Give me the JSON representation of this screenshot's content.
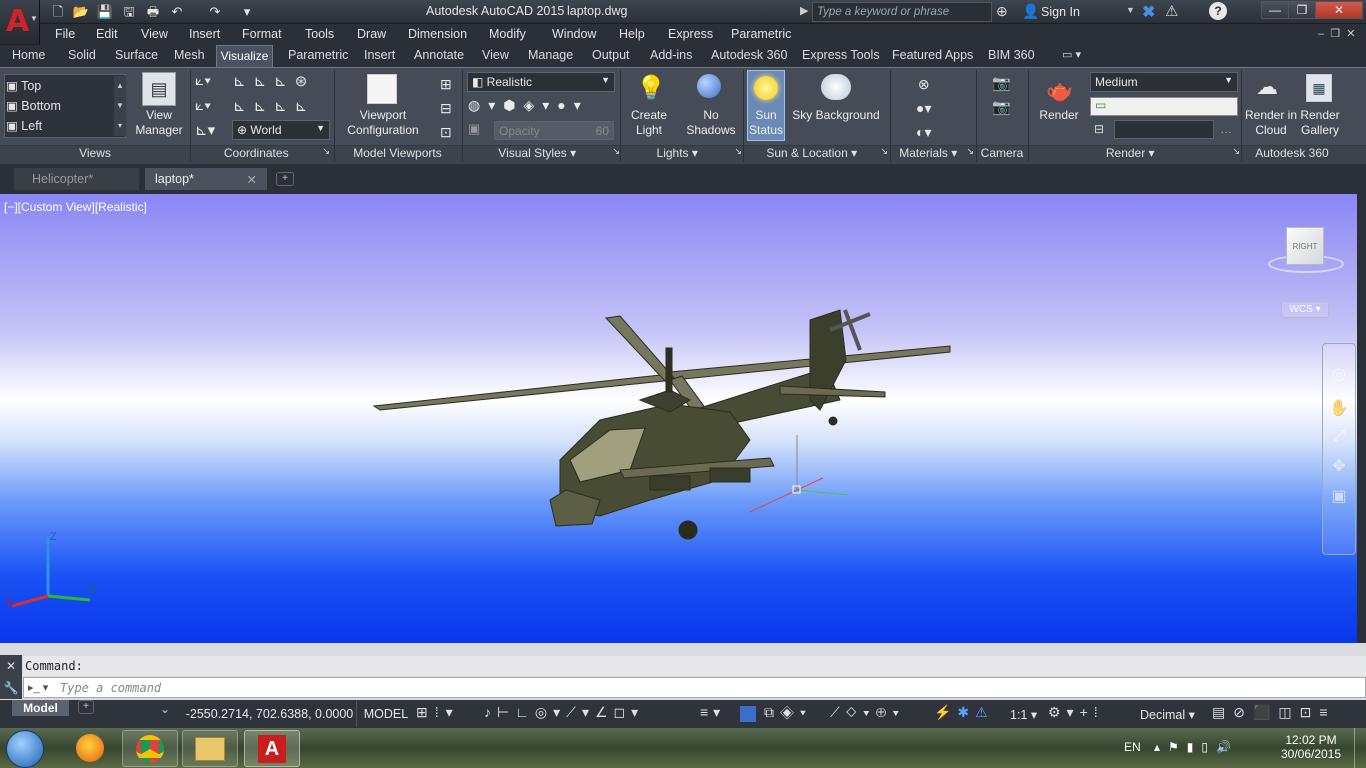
{
  "app": {
    "title": "Autodesk AutoCAD 2015",
    "file": "laptop.dwg",
    "search_placeholder": "Type a keyword or phrase",
    "sign_in": "Sign In"
  },
  "menu": [
    "File",
    "Edit",
    "View",
    "Insert",
    "Format",
    "Tools",
    "Draw",
    "Dimension",
    "Modify",
    "Window",
    "Help",
    "Express",
    "Parametric"
  ],
  "ribbon_tabs": [
    "Home",
    "Solid",
    "Surface",
    "Mesh",
    "Visualize",
    "Parametric",
    "Insert",
    "Annotate",
    "View",
    "Manage",
    "Output",
    "Add-ins",
    "Autodesk 360",
    "Express Tools",
    "Featured Apps",
    "BIM 360"
  ],
  "ribbon": {
    "views_list": [
      "Top",
      "Bottom",
      "Left"
    ],
    "view_manager": "View Manager",
    "coord_system": "World",
    "viewport_config": "Viewport Configuration",
    "visual_style": "Realistic",
    "opacity_label": "Opacity",
    "opacity_value": "60",
    "create_light": "Create Light",
    "no_shadows": "No Shadows",
    "sun_status": "Sun Status",
    "sky_background": "Sky Background",
    "render_quality": "Medium",
    "render": "Render",
    "render_in_cloud": "Render in Cloud",
    "render_gallery": "Render Gallery",
    "panels": [
      "Views",
      "Coordinates",
      "Model Viewports",
      "Visual Styles",
      "Lights",
      "Sun & Location",
      "Materials",
      "Camera",
      "Render",
      "Autodesk 360"
    ]
  },
  "doc_tabs": [
    "Helicopter*",
    "laptop*"
  ],
  "viewport": {
    "label": "[−][Custom View][Realistic]",
    "viewcube_face": "RIGHT",
    "wcs": "WCS"
  },
  "command": {
    "history": "Command:",
    "placeholder": "Type a command"
  },
  "status": {
    "layout_tab": "Model",
    "coords": "-2550.2714, 702.6388, 0.0000",
    "space": "MODEL",
    "scale": "1:1",
    "units": "Decimal"
  },
  "taskbar": {
    "language": "EN",
    "time": "12:02 PM",
    "date": "30/06/2015"
  }
}
